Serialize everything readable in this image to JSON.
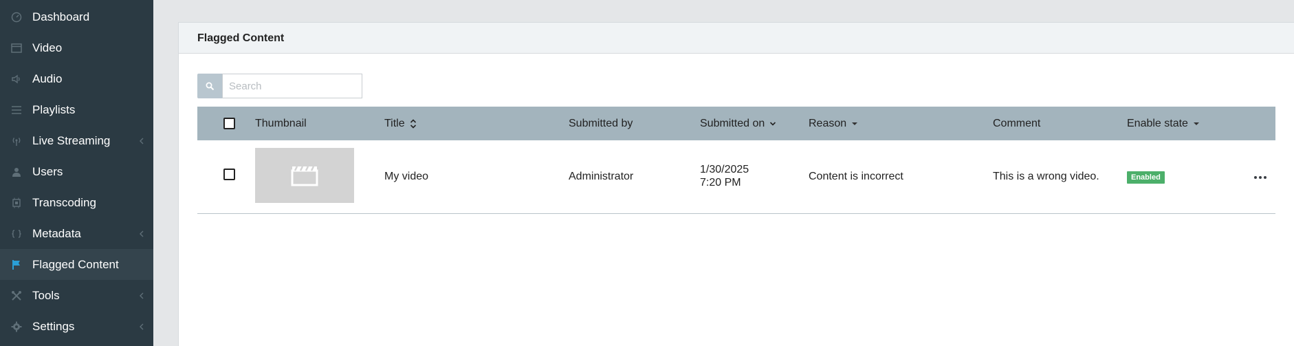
{
  "sidebar": {
    "items": [
      {
        "label": "Dashboard",
        "icon": "dashboard-icon"
      },
      {
        "label": "Video",
        "icon": "video-icon"
      },
      {
        "label": "Audio",
        "icon": "audio-icon"
      },
      {
        "label": "Playlists",
        "icon": "playlist-icon"
      },
      {
        "label": "Live Streaming",
        "icon": "broadcast-icon",
        "submenu": true
      },
      {
        "label": "Users",
        "icon": "user-icon"
      },
      {
        "label": "Transcoding",
        "icon": "chip-icon"
      },
      {
        "label": "Metadata",
        "icon": "code-icon",
        "submenu": true
      },
      {
        "label": "Flagged Content",
        "icon": "flag-icon",
        "active": true
      },
      {
        "label": "Tools",
        "icon": "tools-icon",
        "submenu": true
      },
      {
        "label": "Settings",
        "icon": "gear-icon",
        "submenu": true
      }
    ]
  },
  "panel": {
    "title": "Flagged Content"
  },
  "search": {
    "placeholder": "Search",
    "value": ""
  },
  "table": {
    "columns": {
      "thumbnail": "Thumbnail",
      "title": "Title",
      "submitted_by": "Submitted by",
      "submitted_on": "Submitted on",
      "reason": "Reason",
      "comment": "Comment",
      "enable_state": "Enable state"
    },
    "rows": [
      {
        "title": "My video",
        "submitted_by": "Administrator",
        "submitted_on_date": "1/30/2025",
        "submitted_on_time": "7:20 PM",
        "reason": "Content is incorrect",
        "comment": "This is a wrong video.",
        "enable_state": "Enabled"
      }
    ]
  },
  "colors": {
    "sidebar_bg": "#2b3a43",
    "sidebar_active": "#34444d",
    "flag_accent": "#2a9fd6",
    "table_header": "#a3b4bd",
    "enabled_badge": "#4caf6a"
  }
}
